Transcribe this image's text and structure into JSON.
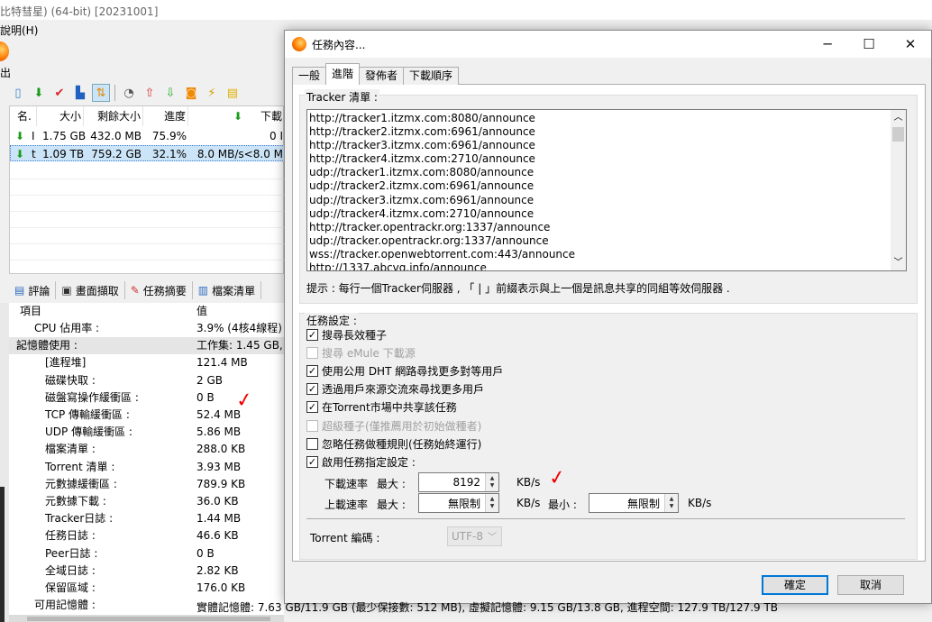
{
  "app": {
    "title": "比特彗星) (64-bit) [20231001]",
    "menu_help": "說明(H)",
    "exit_label": "出",
    "list": {
      "headers": {
        "name": "名.",
        "size": "大小",
        "remaining": "剩餘大小",
        "progress": "進度",
        "download": "下載"
      },
      "rows": [
        {
          "name": "I",
          "size": "1.75 GB",
          "remaining": "432.0 MB",
          "progress": "75.9%",
          "speed": "0 I"
        },
        {
          "name": "t",
          "size": "1.09 TB",
          "remaining": "759.2 GB",
          "progress": "32.1%",
          "speed": "8.0 MB/s<8.0 M"
        }
      ]
    },
    "bottom_tabs": [
      "評論",
      "畫面擷取",
      "任務摘要",
      "檔案清單"
    ],
    "props": {
      "header_key": "項目",
      "header_val": "值",
      "rows": [
        {
          "k": "CPU 佔用率 :",
          "v": "3.9% (4核4線程)",
          "indent": 1
        },
        {
          "k": "記憶體使用 :",
          "v": "工作集: 1.45 GB, 私",
          "indent": 0,
          "expand": "︿"
        },
        {
          "k": "[進程堆]",
          "v": "121.4 MB",
          "indent": 2
        },
        {
          "k": "磁碟快取 :",
          "v": "2 GB",
          "indent": 2
        },
        {
          "k": "磁盤寫操作緩衝區 :",
          "v": "0 B",
          "indent": 2
        },
        {
          "k": "TCP 傳輸緩衝區 :",
          "v": "52.4 MB",
          "indent": 2
        },
        {
          "k": "UDP 傳輸緩衝區 :",
          "v": "5.86 MB",
          "indent": 2
        },
        {
          "k": "檔案清單 :",
          "v": "288.0 KB",
          "indent": 2
        },
        {
          "k": "Torrent 清單 :",
          "v": "3.93 MB",
          "indent": 2
        },
        {
          "k": "元數據緩衝區 :",
          "v": "789.9 KB",
          "indent": 2
        },
        {
          "k": "元數據下載 :",
          "v": "36.0 KB",
          "indent": 2
        },
        {
          "k": "Tracker日誌 :",
          "v": "1.44 MB",
          "indent": 2
        },
        {
          "k": "任務日誌 :",
          "v": "46.6 KB",
          "indent": 2
        },
        {
          "k": "Peer日誌 :",
          "v": "0 B",
          "indent": 2
        },
        {
          "k": "全域日誌 :",
          "v": "2.82 KB",
          "indent": 2
        },
        {
          "k": "保留區域 :",
          "v": "176.0 KB",
          "indent": 2
        },
        {
          "k": "可用記憶體 :",
          "v": "實體記憶體: 7.63 GB/11.9 GB (最少保接數: 512 MB), 虛擬記憶體: 9.15 GB/13.8 GB, 進程空間: 127.9 TB/127.9 TB",
          "indent": 1
        }
      ]
    }
  },
  "dialog": {
    "title": "任務內容...",
    "tabs": [
      "一般",
      "進階",
      "發佈者",
      "下載順序"
    ],
    "active_tab": "進階",
    "tracker_group_label": "Tracker 清單 :",
    "trackers": [
      "http://tracker1.itzmx.com:8080/announce",
      "http://tracker2.itzmx.com:6961/announce",
      "http://tracker3.itzmx.com:6961/announce",
      "http://tracker4.itzmx.com:2710/announce",
      "udp://tracker1.itzmx.com:8080/announce",
      "udp://tracker2.itzmx.com:6961/announce",
      "udp://tracker3.itzmx.com:6961/announce",
      "udp://tracker4.itzmx.com:2710/announce",
      "http://tracker.opentrackr.org:1337/announce",
      "udp://tracker.opentrackr.org:1337/announce",
      "wss://tracker.openwebtorrent.com:443/announce",
      "http://1337.abcvg.info/announce"
    ],
    "tracker_hint": "提示 : 每行一個Tracker伺服器 , 「 | 」前綴表示與上一個是訊息共享的同組等效伺服器 .",
    "task_group_label": "任務設定 :",
    "options": [
      {
        "label": "搜尋長效種子",
        "checked": true,
        "disabled": false
      },
      {
        "label": "搜尋 eMule 下載源",
        "checked": false,
        "disabled": true
      },
      {
        "label": "使用公用 DHT 網路尋找更多對等用戶",
        "checked": true,
        "disabled": false
      },
      {
        "label": "透過用戶來源交流來尋找更多用戶",
        "checked": true,
        "disabled": false
      },
      {
        "label": "在Torrent市場中共享該任務",
        "checked": true,
        "disabled": false
      },
      {
        "label": "超級種子(僅推薦用於初始做種者)",
        "checked": false,
        "disabled": true
      },
      {
        "label": "忽略任務做種規則(任務始終運行)",
        "checked": false,
        "disabled": false
      },
      {
        "label": "啟用任務指定設定 :",
        "checked": true,
        "disabled": false
      }
    ],
    "download_rate_label": "下載速率",
    "upload_rate_label": "上載速率",
    "max_label": "最大 :",
    "min_label": "最小 :",
    "download_max": "8192",
    "upload_max": "無限制",
    "upload_min": "無限制",
    "unit": "KB/s",
    "encoding_label": "Torrent 編碼 :",
    "encoding_value": "UTF-8",
    "ok": "確定",
    "cancel": "取消"
  }
}
